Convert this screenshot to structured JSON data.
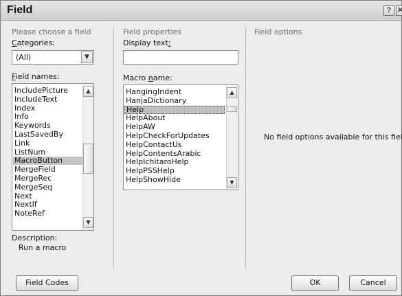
{
  "dialog": {
    "title": "Field",
    "help_glyph": "?",
    "close_glyph": "✕"
  },
  "left_panel": {
    "heading": "Please choose a field",
    "categories_label": "Categories:",
    "categories_value": "(All)",
    "field_names_label": "Field names:",
    "field_names": [
      "IncludePicture",
      "IncludeText",
      "Index",
      "Info",
      "Keywords",
      "LastSavedBy",
      "Link",
      "ListNum",
      "MacroButton",
      "MergeField",
      "MergeRec",
      "MergeSeq",
      "Next",
      "NextIf",
      "NoteRef"
    ],
    "selected_field": "MacroButton",
    "description_label": "Description:",
    "description_text": "Run a macro"
  },
  "middle_panel": {
    "heading": "Field properties",
    "display_text_label": "Display text:",
    "display_text_value": "",
    "macro_name_label": "Macro name:",
    "macro_names": [
      "HangingIndent",
      "HanjaDictionary",
      "Help",
      "HelpAbout",
      "HelpAW",
      "HelpCheckForUpdates",
      "HelpContactUs",
      "HelpContentsArabic",
      "HelpIchitaroHelp",
      "HelpPSSHelp",
      "HelpShowHide"
    ],
    "selected_macro": "Help"
  },
  "right_panel": {
    "heading": "Field options",
    "message": "No field options available for this field"
  },
  "buttons": {
    "field_codes": "Field Codes",
    "ok": "OK",
    "cancel": "Cancel"
  },
  "icons": {
    "arrow_up": "▲",
    "arrow_down": "▼"
  }
}
